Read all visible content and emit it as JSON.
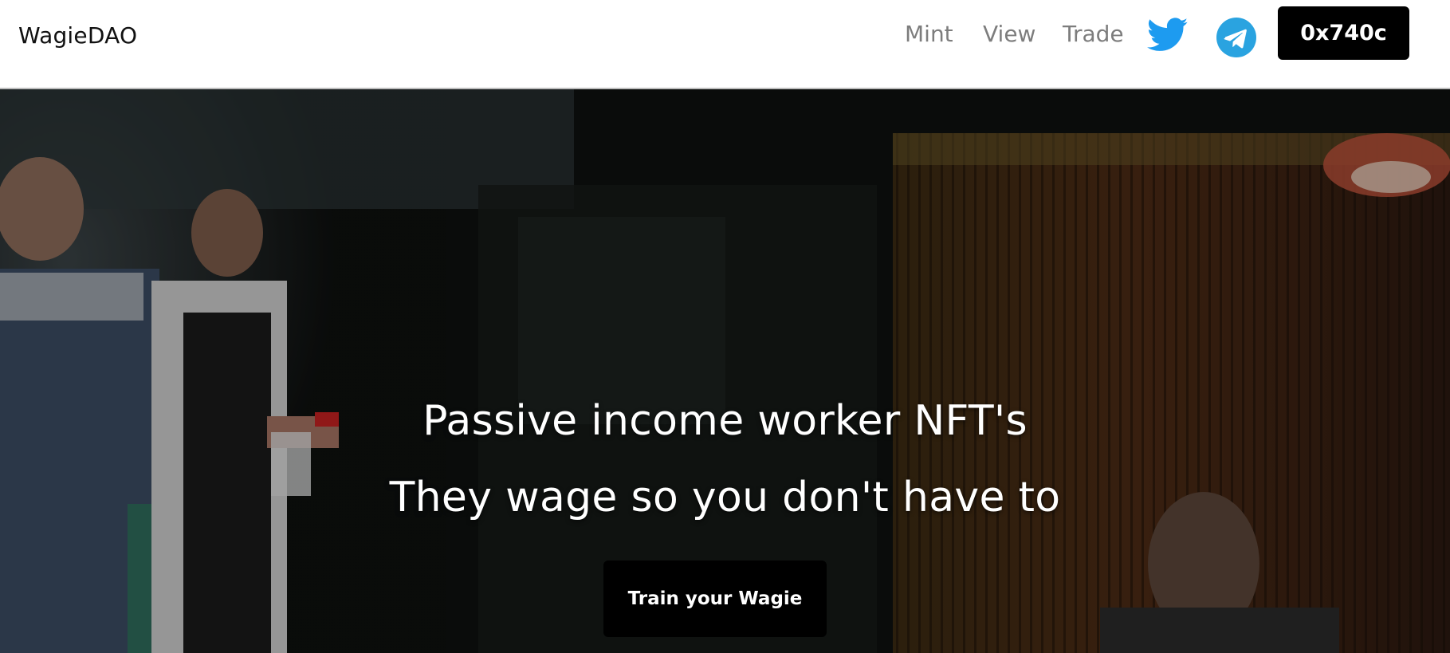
{
  "navbar": {
    "brand": "WagieDAO",
    "links": [
      "Mint",
      "View",
      "Trade"
    ],
    "wallet_label": "0x740c",
    "icons": [
      "twitter-icon",
      "telegram-icon"
    ],
    "colors": {
      "twitter": "#1d9bf0",
      "telegram": "#2aa3e0",
      "link": "#7d7d7d"
    }
  },
  "hero": {
    "headline_line1": "Passive income worker NFT's",
    "headline_line2": "They wage so you don't have to",
    "cta_label": "Train your Wagie"
  }
}
